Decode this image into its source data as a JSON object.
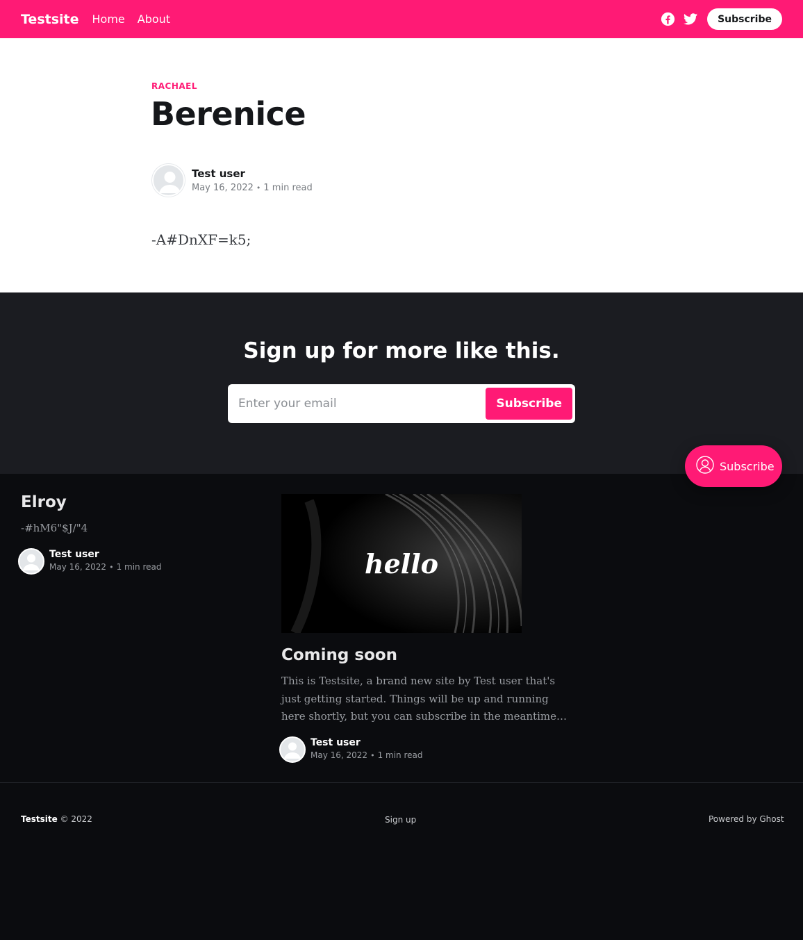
{
  "header": {
    "site_title": "Testsite",
    "nav": [
      {
        "label": "Home"
      },
      {
        "label": "About"
      }
    ],
    "subscribe_label": "Subscribe",
    "social": [
      "facebook-icon",
      "twitter-icon"
    ],
    "background_color": "#ff1a75"
  },
  "article": {
    "tag": "RACHAEL",
    "title": "Berenice",
    "author": {
      "name": "Test user",
      "date": "May 16, 2022",
      "separator": "•",
      "reading_time": "1 min read"
    },
    "body": "-A#DnXF=k5;"
  },
  "cta": {
    "title": "Sign up for more like this.",
    "email_placeholder": "Enter your email",
    "button_label": "Subscribe"
  },
  "portal": {
    "label": "Subscribe",
    "icon": "user-circle-icon"
  },
  "related_posts": [
    {
      "title": "Elroy",
      "excerpt": "-#hM6\"$J/\"4",
      "author": "Test user",
      "date": "May 16, 2022",
      "reading_time": "1 min read"
    },
    {
      "title": "Coming soon",
      "image_text": "hello",
      "excerpt_lines": [
        "This is Testsite, a brand new site by Test user that's",
        "just getting started. Things will be up and running",
        "here shortly, but you can subscribe in the meantime…"
      ],
      "author": "Test user",
      "date": "May 16, 2022",
      "reading_time": "1 min read"
    }
  ],
  "footer": {
    "site_title": "Testsite",
    "copyright": " © 2022",
    "signup_label": "Sign up",
    "powered_by": "Powered by Ghost"
  },
  "colors": {
    "accent": "#ff1a75",
    "dark_bg": "#0b0c0f",
    "cta_bg": "#1b1c21"
  }
}
